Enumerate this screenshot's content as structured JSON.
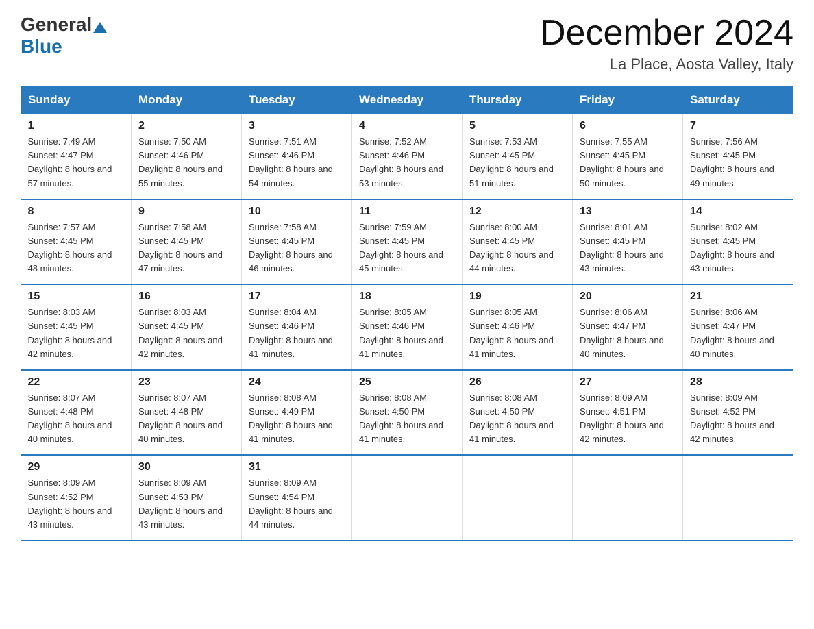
{
  "header": {
    "logo_general": "General",
    "logo_blue": "Blue",
    "month_title": "December 2024",
    "location": "La Place, Aosta Valley, Italy"
  },
  "weekdays": [
    "Sunday",
    "Monday",
    "Tuesday",
    "Wednesday",
    "Thursday",
    "Friday",
    "Saturday"
  ],
  "weeks": [
    [
      {
        "day": "1",
        "sunrise": "7:49 AM",
        "sunset": "4:47 PM",
        "daylight": "8 hours and 57 minutes."
      },
      {
        "day": "2",
        "sunrise": "7:50 AM",
        "sunset": "4:46 PM",
        "daylight": "8 hours and 55 minutes."
      },
      {
        "day": "3",
        "sunrise": "7:51 AM",
        "sunset": "4:46 PM",
        "daylight": "8 hours and 54 minutes."
      },
      {
        "day": "4",
        "sunrise": "7:52 AM",
        "sunset": "4:46 PM",
        "daylight": "8 hours and 53 minutes."
      },
      {
        "day": "5",
        "sunrise": "7:53 AM",
        "sunset": "4:45 PM",
        "daylight": "8 hours and 51 minutes."
      },
      {
        "day": "6",
        "sunrise": "7:55 AM",
        "sunset": "4:45 PM",
        "daylight": "8 hours and 50 minutes."
      },
      {
        "day": "7",
        "sunrise": "7:56 AM",
        "sunset": "4:45 PM",
        "daylight": "8 hours and 49 minutes."
      }
    ],
    [
      {
        "day": "8",
        "sunrise": "7:57 AM",
        "sunset": "4:45 PM",
        "daylight": "8 hours and 48 minutes."
      },
      {
        "day": "9",
        "sunrise": "7:58 AM",
        "sunset": "4:45 PM",
        "daylight": "8 hours and 47 minutes."
      },
      {
        "day": "10",
        "sunrise": "7:58 AM",
        "sunset": "4:45 PM",
        "daylight": "8 hours and 46 minutes."
      },
      {
        "day": "11",
        "sunrise": "7:59 AM",
        "sunset": "4:45 PM",
        "daylight": "8 hours and 45 minutes."
      },
      {
        "day": "12",
        "sunrise": "8:00 AM",
        "sunset": "4:45 PM",
        "daylight": "8 hours and 44 minutes."
      },
      {
        "day": "13",
        "sunrise": "8:01 AM",
        "sunset": "4:45 PM",
        "daylight": "8 hours and 43 minutes."
      },
      {
        "day": "14",
        "sunrise": "8:02 AM",
        "sunset": "4:45 PM",
        "daylight": "8 hours and 43 minutes."
      }
    ],
    [
      {
        "day": "15",
        "sunrise": "8:03 AM",
        "sunset": "4:45 PM",
        "daylight": "8 hours and 42 minutes."
      },
      {
        "day": "16",
        "sunrise": "8:03 AM",
        "sunset": "4:45 PM",
        "daylight": "8 hours and 42 minutes."
      },
      {
        "day": "17",
        "sunrise": "8:04 AM",
        "sunset": "4:46 PM",
        "daylight": "8 hours and 41 minutes."
      },
      {
        "day": "18",
        "sunrise": "8:05 AM",
        "sunset": "4:46 PM",
        "daylight": "8 hours and 41 minutes."
      },
      {
        "day": "19",
        "sunrise": "8:05 AM",
        "sunset": "4:46 PM",
        "daylight": "8 hours and 41 minutes."
      },
      {
        "day": "20",
        "sunrise": "8:06 AM",
        "sunset": "4:47 PM",
        "daylight": "8 hours and 40 minutes."
      },
      {
        "day": "21",
        "sunrise": "8:06 AM",
        "sunset": "4:47 PM",
        "daylight": "8 hours and 40 minutes."
      }
    ],
    [
      {
        "day": "22",
        "sunrise": "8:07 AM",
        "sunset": "4:48 PM",
        "daylight": "8 hours and 40 minutes."
      },
      {
        "day": "23",
        "sunrise": "8:07 AM",
        "sunset": "4:48 PM",
        "daylight": "8 hours and 40 minutes."
      },
      {
        "day": "24",
        "sunrise": "8:08 AM",
        "sunset": "4:49 PM",
        "daylight": "8 hours and 41 minutes."
      },
      {
        "day": "25",
        "sunrise": "8:08 AM",
        "sunset": "4:50 PM",
        "daylight": "8 hours and 41 minutes."
      },
      {
        "day": "26",
        "sunrise": "8:08 AM",
        "sunset": "4:50 PM",
        "daylight": "8 hours and 41 minutes."
      },
      {
        "day": "27",
        "sunrise": "8:09 AM",
        "sunset": "4:51 PM",
        "daylight": "8 hours and 42 minutes."
      },
      {
        "day": "28",
        "sunrise": "8:09 AM",
        "sunset": "4:52 PM",
        "daylight": "8 hours and 42 minutes."
      }
    ],
    [
      {
        "day": "29",
        "sunrise": "8:09 AM",
        "sunset": "4:52 PM",
        "daylight": "8 hours and 43 minutes."
      },
      {
        "day": "30",
        "sunrise": "8:09 AM",
        "sunset": "4:53 PM",
        "daylight": "8 hours and 43 minutes."
      },
      {
        "day": "31",
        "sunrise": "8:09 AM",
        "sunset": "4:54 PM",
        "daylight": "8 hours and 44 minutes."
      },
      null,
      null,
      null,
      null
    ]
  ]
}
